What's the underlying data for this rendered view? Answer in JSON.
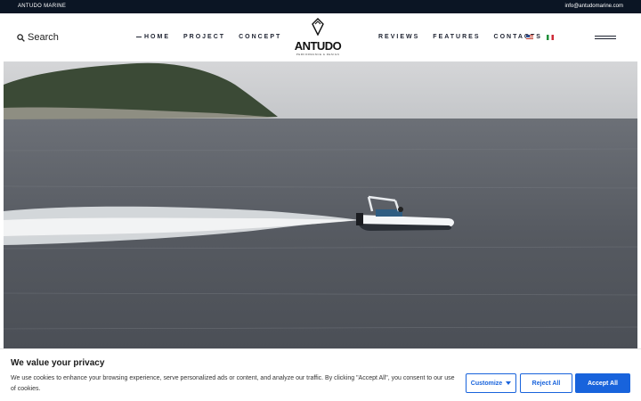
{
  "topbar": {
    "brand": "ANTUDO MARINE",
    "email": "info@antudomarine.com"
  },
  "header": {
    "search_label": "Search",
    "nav_left": [
      "HOME",
      "PROJECT",
      "CONCEPT"
    ],
    "nav_right": [
      "REVIEWS",
      "FEATURES",
      "CONTACTS"
    ],
    "logo_word": "ANTUDO",
    "logo_tag": "PERFORMANCE & DESIGN",
    "languages": [
      "en-flag-icon",
      "it-flag-icon"
    ]
  },
  "hero": {
    "image": "speedboat on open sea video frame"
  },
  "cookie": {
    "title": "We value your privacy",
    "text": "We use cookies to enhance your browsing experience, serve personalized ads or content, and analyze our traffic. By clicking \"Accept All\", you consent to our use of cookies.",
    "customize": "Customize",
    "reject": "Reject All",
    "accept": "Accept All"
  },
  "colors": {
    "topbar_bg": "#0b1524",
    "accent": "#1863dc"
  }
}
